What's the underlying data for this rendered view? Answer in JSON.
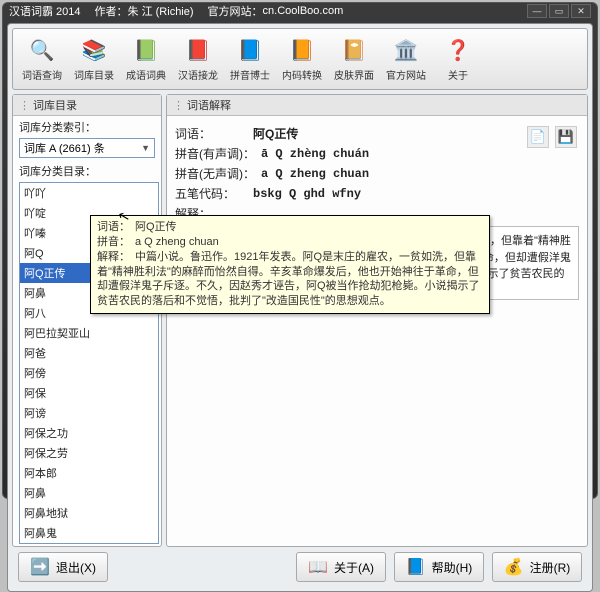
{
  "title": {
    "app": "汉语词霸 2014",
    "author_label": "作者：",
    "author": "朱 江 (Richie)",
    "site_label": "官方网站：",
    "site": "cn.CoolBoo.com"
  },
  "toolbar": [
    {
      "label": "词语查询",
      "icon": "🔍"
    },
    {
      "label": "词库目录",
      "icon": "📚"
    },
    {
      "label": "成语词典",
      "icon": "📗"
    },
    {
      "label": "汉语接龙",
      "icon": "📕"
    },
    {
      "label": "拼音博士",
      "icon": "📘"
    },
    {
      "label": "内码转换",
      "icon": "📙"
    },
    {
      "label": "皮肤界面",
      "icon": "📔"
    },
    {
      "label": "官方网站",
      "icon": "🏛️"
    },
    {
      "label": "关于",
      "icon": "❓"
    }
  ],
  "left": {
    "header": "词库目录",
    "index_label": "词库分类索引：",
    "combo": "词库 A (2661) 条",
    "list_label": "词库分类目录：",
    "items": [
      "吖吖",
      "吖啶",
      "吖嗪",
      "阿Q",
      "阿Q正传",
      "阿鼻",
      "阿八",
      "阿巴拉契亚山",
      "阿爸",
      "阿傍",
      "阿保",
      "阿谤",
      "阿保之功",
      "阿保之劳",
      "阿本郎",
      "阿鼻",
      "阿鼻地狱",
      "阿鼻鬼"
    ],
    "selected": "阿Q正传"
  },
  "right": {
    "header": "词语解释",
    "word_label": "词语：",
    "word": "阿Q正传",
    "py1_label": "拼音(有声调)：",
    "py1": "ā Q zhèng chuán",
    "py2_label": "拼音(无声调)：",
    "py2": "a Q zheng chuan",
    "wubi_label": "五笔代码：",
    "wubi": "bskg Q ghd wfny",
    "def_label": "解释：",
    "def": "中篇小说。鲁迅作。1921年发表。阿Q是末庄的雇农，一贫如洗，但靠着\"精神胜利法\"的麻醉而怡然自得。辛亥革命爆发后，他也开始神往于革命，但却遭假洋鬼子斥逐。不久，因赵秀才诬告，阿Q被当作抢劫犯枪毙。小说揭示了贫苦农民的落后和不觉悟，批判了\"改造国民性\"的思想观点。"
  },
  "tooltip": {
    "l1k": "词语：",
    "l1v": "阿Q正传",
    "l2k": "拼音：",
    "l2v": "a Q zheng chuan",
    "l3k": "解释：",
    "l3v": "中篇小说。鲁迅作。1921年发表。阿Q是末庄的雇农，一贫如洗，但靠着\"精神胜利法\"的麻醉而怡然自得。辛亥革命爆发后，他也开始神往于革命，但却遭假洋鬼子斥逐。不久，因赵秀才诬告，阿Q被当作抢劫犯枪毙。小说揭示了贫苦农民的落后和不觉悟，批判了\"改造国民性\"的思想观点。"
  },
  "footer": {
    "exit": "退出(X)",
    "about": "关于(A)",
    "help": "帮助(H)",
    "register": "注册(R)"
  }
}
